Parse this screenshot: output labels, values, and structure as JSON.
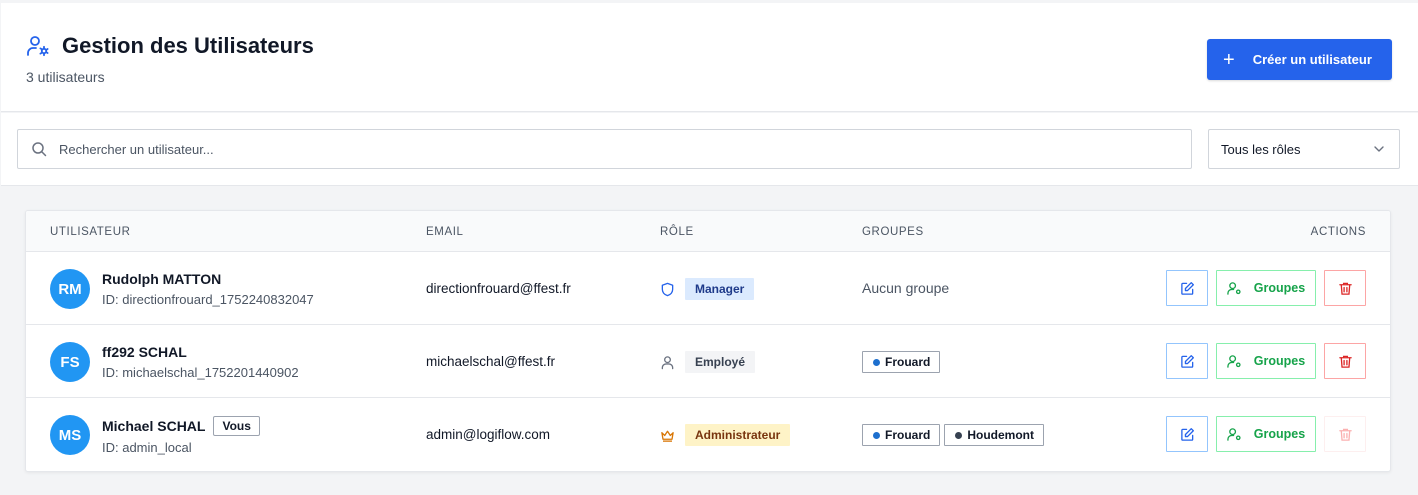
{
  "header": {
    "title": "Gestion des Utilisateurs",
    "subtitle": "3 utilisateurs",
    "create_label": "Créer un utilisateur",
    "accent": "#2563eb"
  },
  "toolbar": {
    "search_placeholder": "Rechercher un utilisateur...",
    "role_filter": "Tous les rôles"
  },
  "table": {
    "columns": {
      "user": "UTILISATEUR",
      "email": "EMAIL",
      "role": "RÔLE",
      "groups": "GROUPES",
      "actions": "ACTIONS"
    },
    "groups_btn": "Groupes",
    "no_group": "Aucun groupe",
    "you_label": "Vous",
    "rows": [
      {
        "initials": "RM",
        "name": "Rudolph MATTON",
        "id": "ID: directionfrouard_1752240832047",
        "email": "directionfrouard@ffest.fr",
        "role": "Manager",
        "role_icon": "shield-icon"
      },
      {
        "initials": "FS",
        "name": "ff292 SCHAL",
        "id": "ID: michaelschal_1752201440902",
        "email": "michaelschal@ffest.fr",
        "role": "Employé",
        "role_icon": "user-icon",
        "groups": [
          {
            "name": "Frouard",
            "color": "#1d6fce"
          }
        ]
      },
      {
        "initials": "MS",
        "name": "Michael SCHAL",
        "id": "ID: admin_local",
        "email": "admin@logiflow.com",
        "role": "Administrateur",
        "role_icon": "crown-icon",
        "groups": [
          {
            "name": "Frouard",
            "color": "#1d6fce"
          },
          {
            "name": "Houdemont",
            "color": "#374151"
          }
        ]
      }
    ]
  }
}
